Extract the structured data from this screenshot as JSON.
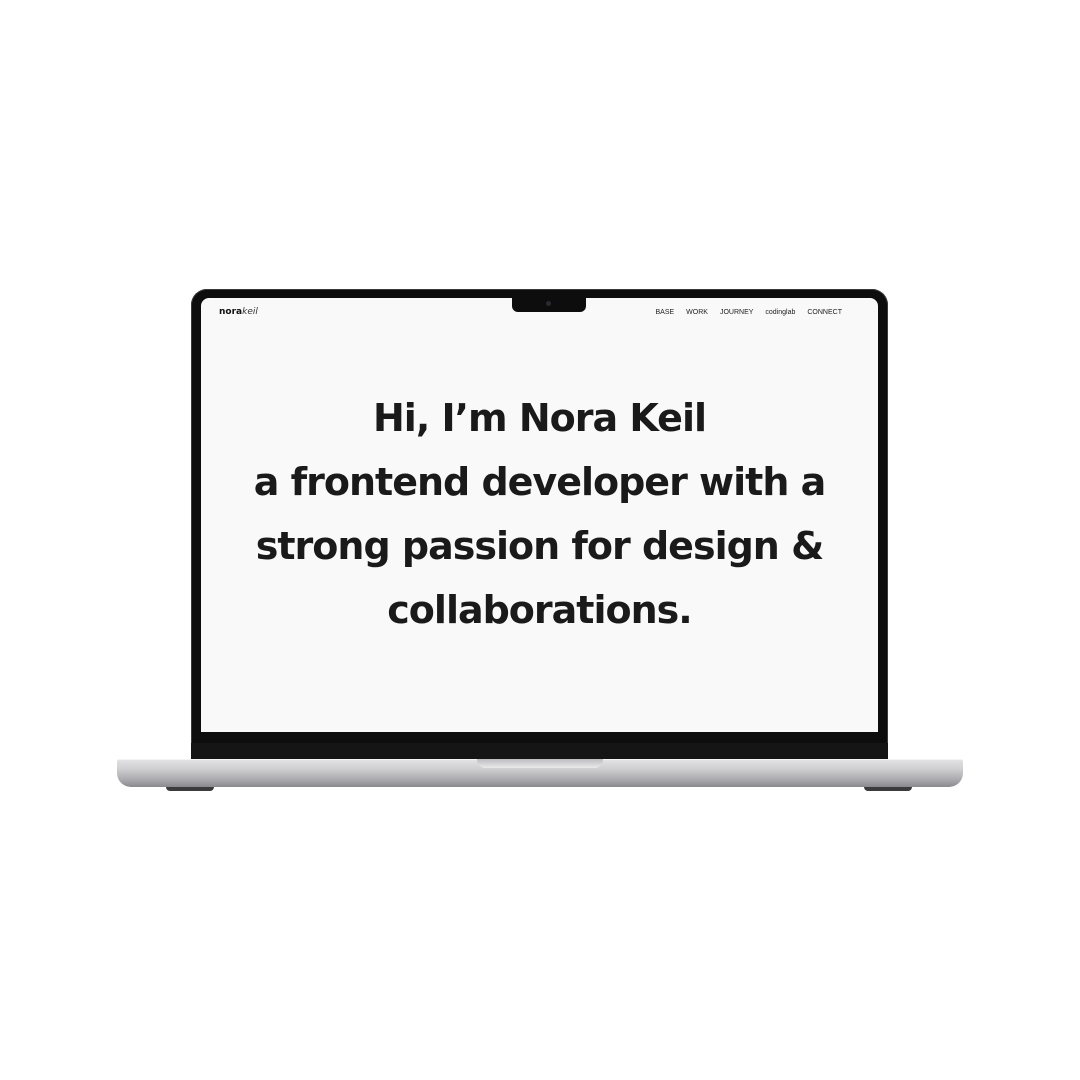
{
  "site": {
    "logo": {
      "first": "nora",
      "second": "keil"
    },
    "nav": {
      "items": [
        "BASE",
        "WORK",
        "JOURNEY",
        "codinglab",
        "CONNECT"
      ]
    },
    "hero": {
      "lines": [
        "Hi, I’m Nora Keil",
        "a frontend developer with a",
        "strong passion for design &",
        "collaborations."
      ]
    }
  },
  "colors": {
    "page_background": "#ffffff",
    "screen_background": "#f9f9f9",
    "bezel": "#0d0d0d",
    "text": "#1a1a1a",
    "aluminium": "#cfcfd2"
  }
}
